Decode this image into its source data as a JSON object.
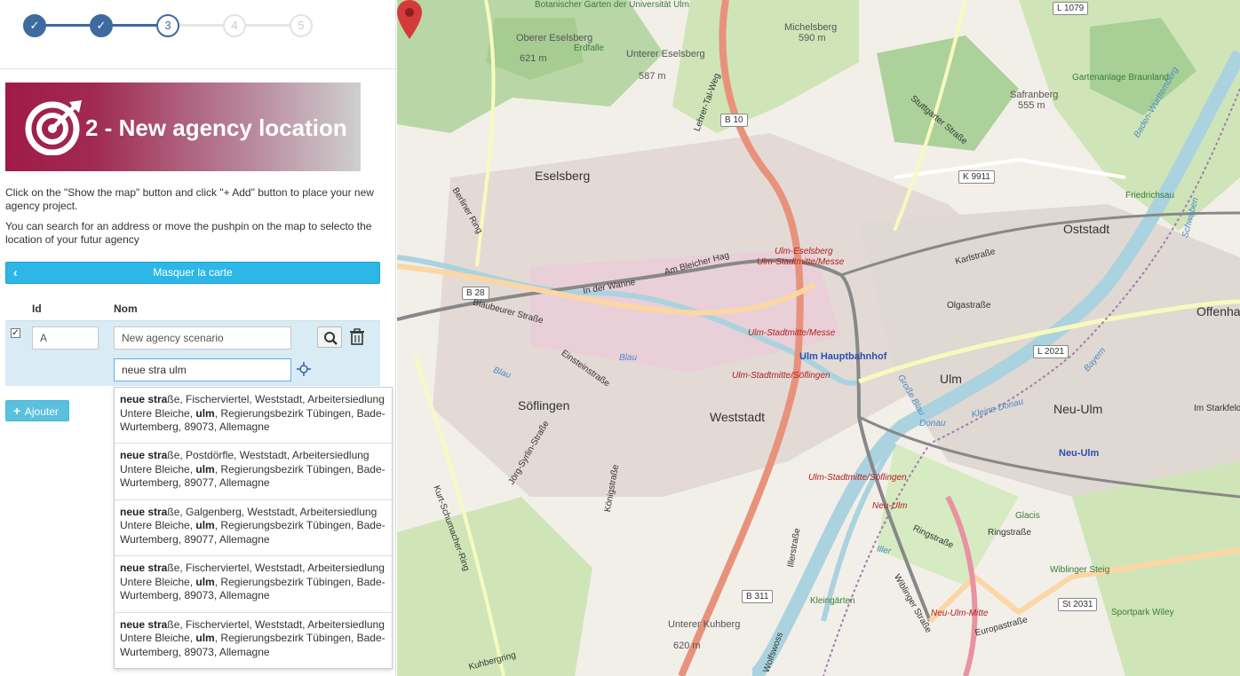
{
  "stepper": {
    "steps": [
      {
        "label": "✓",
        "state": "done"
      },
      {
        "label": "✓",
        "state": "done"
      },
      {
        "label": "3",
        "state": "current"
      },
      {
        "label": "4",
        "state": "todo"
      },
      {
        "label": "5",
        "state": "todo"
      }
    ]
  },
  "banner": {
    "title": "2 - New agency location",
    "icon": "target-icon"
  },
  "help": {
    "line1": "Click on the \"Show the map\" button and click \"+ Add\" button to place your new agency project.",
    "line2": "You can search for an address or move the pushpin on the map to selecto the location of your futur agency"
  },
  "map_toggle": {
    "label": "Masquer la carte",
    "chevron": "‹"
  },
  "table": {
    "headers": {
      "id": "Id",
      "name": "Nom"
    },
    "row": {
      "checked": true,
      "id": "A",
      "name": "New agency scenario",
      "search": "neue stra ulm"
    }
  },
  "add_button": {
    "icon": "+",
    "label": "Ajouter"
  },
  "suggestions": [
    {
      "bold": "neue stra",
      "rest1": "ße, Fischerviertel, Weststadt, Arbeitersiedlung Untere Bleiche, ",
      "bold2": "ulm",
      "rest2": ", Regierungsbezirk Tübingen, Bade-Wurtemberg, 89073, Allemagne"
    },
    {
      "bold": "neue stra",
      "rest1": "ße, Postdörfle, Weststadt, Arbeitersiedlung Untere Bleiche, ",
      "bold2": "ulm",
      "rest2": ", Regierungsbezirk Tübingen, Bade-Wurtemberg, 89077, Allemagne"
    },
    {
      "bold": "neue stra",
      "rest1": "ße, Galgenberg, Weststadt, Arbeitersiedlung Untere Bleiche, ",
      "bold2": "ulm",
      "rest2": ", Regierungsbezirk Tübingen, Bade-Wurtemberg, 89077, Allemagne"
    },
    {
      "bold": "neue stra",
      "rest1": "ße, Fischerviertel, Weststadt, Arbeitersiedlung Untere Bleiche, ",
      "bold2": "ulm",
      "rest2": ", Regierungsbezirk Tübingen, Bade-Wurtemberg, 89073, Allemagne"
    },
    {
      "bold": "neue stra",
      "rest1": "ße, Fischerviertel, Weststadt, Arbeitersiedlung Untere Bleiche, ",
      "bold2": "ulm",
      "rest2": ", Regierungsbezirk Tübingen, Bade-Wurtemberg, 89073, Allemagne"
    }
  ],
  "map": {
    "places": {
      "ulm": "Ulm",
      "neu_ulm": "Neu-Ulm",
      "oststadt": "Oststadt",
      "offenhausen": "Offenha",
      "eselsberg": "Eselsberg",
      "soeflingen": "Söflingen",
      "weststadt": "Weststadt"
    },
    "peaks": {
      "ober": "Oberer Eselsberg",
      "ober_h": "621 m",
      "unter": "Unterer Eselsberg",
      "unter_h": "587 m",
      "michels": "Michelsberg",
      "michels_h": "590 m",
      "safran": "Safranberg",
      "safran_h": "555 m",
      "kuhberg": "Unterer Kuhberg",
      "kuhberg_h": "620 m"
    },
    "stations": {
      "hbf": "Ulm Hauptbahnhof",
      "eselsberg": "Ulm-Eselsberg",
      "messe": "Ulm-Stadtmitte/Messe",
      "messe2": "Ulm-Stadtmitte/Messe",
      "soeflingen": "Ulm-Stadtmitte/Söflingen",
      "soeflingen2": "Ulm-Stadtmitte/Söflingen",
      "neuulm": "Neu-Ulm",
      "neuulm_mitte": "Neu-Ulm-Mitte"
    },
    "neuulm_blue": "Neu-Ulm",
    "shields": [
      "B 10",
      "B 28",
      "K 9911",
      "L 1079",
      "L 2021",
      "B 311",
      "St 2031"
    ],
    "roads": {
      "berliner": "Berliner Ring",
      "stuttgarter": "Stuttgarter Straße",
      "karl": "Karlstraße",
      "olga": "Olgastraße",
      "blaubeurer": "Blaubeurer Straße",
      "wanne": "In der Wanne",
      "bleich": "Am Bleicher Hag",
      "einstein": "Einsteinstraße",
      "koenig": "Königstraße",
      "iller": "Illerstraße",
      "wiblinger": "Wiblinger Straße",
      "ring": "Ringstraße",
      "ring2": "Ringstraße",
      "europa": "Europastraße",
      "kurt": "Kurt-Schumacher-Ring",
      "joerg": "Jörg-Syrlin-Straße",
      "lehrer": "Lehrer-Tal-Weg",
      "kuhberg": "Kuhbergring",
      "imstark": "Im Starkfeld",
      "wolfswoss": "Wolfswoss"
    },
    "water": {
      "blau": "Blau",
      "blau2": "Blau",
      "donau": "Große Blau",
      "kleine": "Kleine Donau",
      "donau2": "Donau",
      "iller": "Iller",
      "bayern": "Bayern",
      "schwaben": "Schwaben"
    },
    "parks": {
      "bot": "Botanischer Garten der Universität Ulm",
      "erdfalle": "Erdfalle",
      "gartenanlage": "Gartenanlage Braunland",
      "friedrichsau": "Friedrichsau",
      "glacis": "Glacis",
      "wiblingen": "Wiblinger Steig",
      "sportpark": "Sportpark Wiley",
      "kleingarten": "Kleingärten"
    },
    "ring_label": "Baden-Württemberg"
  }
}
